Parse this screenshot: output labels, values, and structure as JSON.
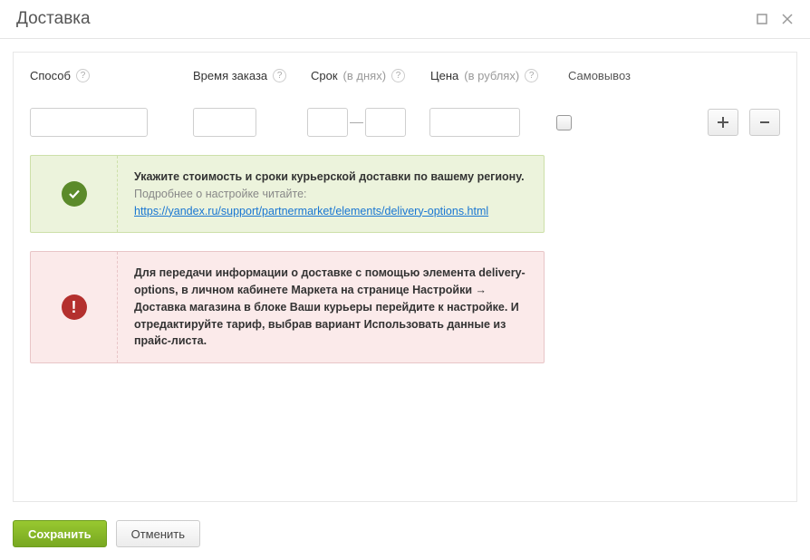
{
  "window": {
    "title": "Доставка"
  },
  "headers": {
    "method": "Способ",
    "order_time": "Время заказа",
    "duration": "Срок",
    "duration_hint": "(в днях)",
    "price": "Цена",
    "price_hint": "(в рублях)",
    "pickup": "Самовывоз"
  },
  "row": {
    "method": "",
    "time": "",
    "dur_from": "",
    "dur_to": "",
    "price": "",
    "pickup_checked": false
  },
  "alerts": {
    "success": {
      "title": "Укажите стоимость и сроки курьерской доставки по вашему региону.",
      "subtitle": "Подробнее о настройке читайте:",
      "link": "https://yandex.ru/support/partnermarket/elements/delivery-options.html"
    },
    "error": {
      "text": "Для передачи информации о доставке с помощью элемента delivery-options, в личном кабинете Маркета на странице Настройки → Доставка магазина в блоке Ваши курьеры перейдите к настройке. И отредактируйте тариф, выбрав вариант Использовать данные из прайс-листа."
    }
  },
  "buttons": {
    "save": "Сохранить",
    "cancel": "Отменить"
  }
}
